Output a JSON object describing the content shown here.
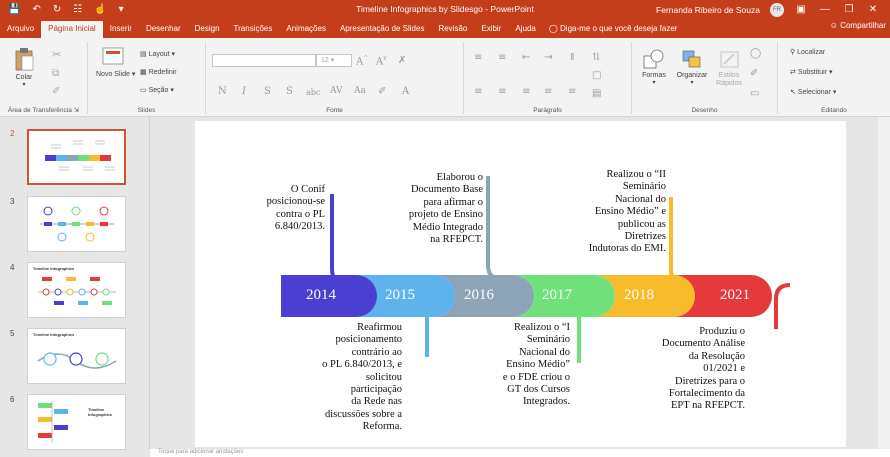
{
  "titlebar": {
    "doc_title": "Timeline Infographics by Slidesgo  -  PowerPoint",
    "user_name": "Fernanda Ribeiro de Souza",
    "user_initials": "FR"
  },
  "tabs": [
    "Arquivo",
    "Página Inicial",
    "Inserir",
    "Desenhar",
    "Design",
    "Transições",
    "Animações",
    "Apresentação de Slides",
    "Revisão",
    "Exibir",
    "Ajuda"
  ],
  "tell_me": "Diga-me o que você deseja fazer",
  "share": "Compartilhar",
  "ribbon": {
    "clipboard": {
      "paste": "Colar",
      "label": "Área de Transferência"
    },
    "slides": {
      "new_slide": "Novo Slide",
      "layout": "Layout",
      "reset": "Redefinir",
      "section": "Seção",
      "label": "Slides"
    },
    "font": {
      "label": "Fonte",
      "size": "12"
    },
    "paragraph": {
      "label": "Parágrafo"
    },
    "drawing": {
      "shapes": "Formas",
      "arrange": "Organizar",
      "quick_styles": "Estilos Rápidos",
      "label": "Desenho"
    },
    "editing": {
      "find": "Localizar",
      "replace": "Substituir",
      "select": "Selecionar",
      "label": "Editando"
    }
  },
  "thumbnails": [
    {
      "number": "2"
    },
    {
      "number": "3"
    },
    {
      "number": "4"
    },
    {
      "number": "5"
    },
    {
      "number": "6"
    }
  ],
  "thumb_titles": {
    "t4": "Timeline Infographics",
    "t5": "Timeline Infographics",
    "t6": "Timeline Infographics"
  },
  "notes_placeholder": "Toque para adicionar anotações",
  "timeline": {
    "years": [
      "2014",
      "2015",
      "2016",
      "2017",
      "2018",
      "2021"
    ],
    "colors": [
      "#4b3fd1",
      "#5fb3ec",
      "#8da3b6",
      "#6fe07a",
      "#f7bb2c",
      "#e6393c"
    ],
    "above": {
      "t2014": [
        "O Conif",
        "posicionou-se",
        "contra o PL",
        "6.840/2013."
      ],
      "t2016": [
        "Elaborou o",
        "Documento Base",
        "para afirmar o",
        "projeto de Ensino",
        "Médio Integrado",
        "na RFEPCT."
      ],
      "t2018": [
        "Realizou o “II",
        "Seminário",
        "Nacional do",
        "Ensino Médio” e",
        "publicou as",
        "Diretrizes",
        "Indutoras do EMI."
      ]
    },
    "below": {
      "t2015": [
        "Reafirmou",
        "posicionamento",
        "contrário ao",
        "o PL 6.840/2013, e",
        "solicitou",
        "participação",
        "da Rede nas",
        "discussões sobre a",
        "Reforma."
      ],
      "t2017": [
        "Realizou o “I",
        "Seminário",
        "Nacional do",
        "Ensino Médio”",
        "e o FDE criou o",
        "GT dos Cursos",
        "Integrados."
      ],
      "t2021": [
        "Produziu o",
        "Documento Análise",
        "da Resolução",
        "01/2021 e",
        "Diretrizes para o",
        "Fortalecimento da",
        "EPT na RFEPCT."
      ]
    }
  }
}
